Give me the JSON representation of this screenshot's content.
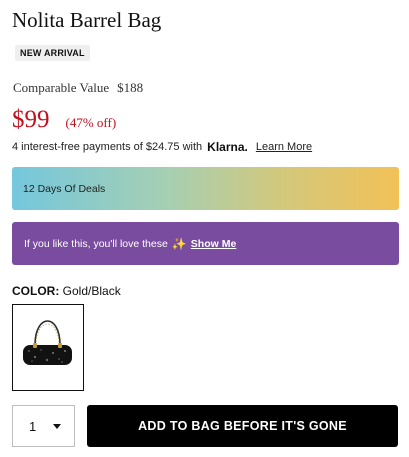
{
  "product": {
    "title": "Nolita Barrel Bag",
    "badge": "NEW ARRIVAL",
    "comparable_label": "Comparable Value",
    "comparable_price": "$188",
    "price": "$99",
    "discount": "(47% off)"
  },
  "klarna": {
    "text": "4 interest-free payments of $24.75 with",
    "brand": "Klarna.",
    "learn_more": "Learn More"
  },
  "deals_banner": {
    "label": "12 Days Of Deals"
  },
  "promo_banner": {
    "text": "If you like this, you'll love these",
    "icon": "sparkle-icon",
    "link": "Show Me"
  },
  "color": {
    "label": "COLOR:",
    "value": "Gold/Black",
    "swatches": [
      {
        "name": "Gold/Black",
        "selected": true
      }
    ]
  },
  "quantity": {
    "value": "1"
  },
  "cta": {
    "label": "ADD TO BAG BEFORE IT'S GONE"
  },
  "colors": {
    "price_red": "#c0101e",
    "promo_purple": "#7a4c9f",
    "deals_gradient_start": "#74c7dd",
    "deals_gradient_end": "#f2c158",
    "cta_black": "#000000"
  }
}
